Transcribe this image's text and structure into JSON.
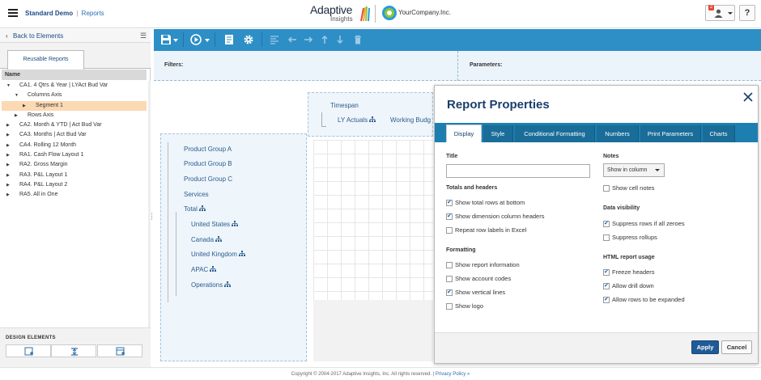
{
  "header": {
    "app_name": "Standard Demo",
    "separator": "|",
    "section": "Reports",
    "logo_main": "Adaptive",
    "logo_sub": "Insights",
    "company_logo": "YourCompany.Inc.",
    "notification_count": "2",
    "help_label": "?"
  },
  "sidebar": {
    "back_label": "Back to Elements",
    "tab_label": "Reusable Reports",
    "tree_header": "Name",
    "tree": [
      {
        "label": "CA1. 4 Qtrs & Year | LYAct Bud Var",
        "level": 0,
        "toggle": "▼",
        "selected": false
      },
      {
        "label": "Columns Axis",
        "level": 1,
        "toggle": "▼",
        "selected": false
      },
      {
        "label": "Segment 1",
        "level": 2,
        "toggle": "▶",
        "selected": true
      },
      {
        "label": "Rows Axis",
        "level": 1,
        "toggle": "▶",
        "selected": false
      },
      {
        "label": "CA2. Month & YTD | Act Bud Var",
        "level": 0,
        "toggle": "▶",
        "selected": false
      },
      {
        "label": "CA3. Months | Act Bud Var",
        "level": 0,
        "toggle": "▶",
        "selected": false
      },
      {
        "label": "CA4. Rolling 12 Month",
        "level": 0,
        "toggle": "▶",
        "selected": false
      },
      {
        "label": "RA1. Cash Flow Layout 1",
        "level": 0,
        "toggle": "▶",
        "selected": false
      },
      {
        "label": "RA2. Gross Margin",
        "level": 0,
        "toggle": "▶",
        "selected": false
      },
      {
        "label": "RA3. P&L Layout 1",
        "level": 0,
        "toggle": "▶",
        "selected": false
      },
      {
        "label": "RA4. P&L Layout 2",
        "level": 0,
        "toggle": "▶",
        "selected": false
      },
      {
        "label": "RA5. All in One",
        "level": 0,
        "toggle": "▶",
        "selected": false
      }
    ],
    "design_title": "DESIGN ELEMENTS"
  },
  "filters": {
    "filters_label": "Filters:",
    "parameters_label": "Parameters:"
  },
  "report": {
    "timespan": "Timespan",
    "col1": "LY Actuals",
    "col2": "Working Budg",
    "rows": [
      {
        "label": "Product Group A",
        "indent": 0,
        "tree_icon": false
      },
      {
        "label": "Product Group B",
        "indent": 0,
        "tree_icon": false
      },
      {
        "label": "Product Group C",
        "indent": 0,
        "tree_icon": false
      },
      {
        "label": "Services",
        "indent": 0,
        "tree_icon": false
      },
      {
        "label": "Total",
        "indent": 0,
        "tree_icon": true
      },
      {
        "label": "United States",
        "indent": 1,
        "tree_icon": true
      },
      {
        "label": "Canada",
        "indent": 1,
        "tree_icon": true
      },
      {
        "label": "United Kingdom",
        "indent": 1,
        "tree_icon": true
      },
      {
        "label": "APAC",
        "indent": 1,
        "tree_icon": true
      },
      {
        "label": "Operations",
        "indent": 1,
        "tree_icon": true
      }
    ]
  },
  "modal": {
    "title": "Report Properties",
    "tabs": [
      "Display",
      "Style",
      "Conditional Formatting",
      "Numbers",
      "Print Parameters",
      "Charts"
    ],
    "active_tab": "Display",
    "title_label": "Title",
    "title_value": "",
    "totals_label": "Totals and headers",
    "totals": [
      {
        "label": "Show total rows at bottom",
        "checked": true
      },
      {
        "label": "Show dimension column headers",
        "checked": true
      },
      {
        "label": "Repeat row labels in Excel",
        "checked": false
      }
    ],
    "formatting_label": "Formatting",
    "formatting": [
      {
        "label": "Show report information",
        "checked": false
      },
      {
        "label": "Show account codes",
        "checked": false
      },
      {
        "label": "Show vertical lines",
        "checked": true
      },
      {
        "label": "Show logo",
        "checked": false
      }
    ],
    "notes_label": "Notes",
    "notes_select": "Show in column",
    "notes": [
      {
        "label": "Show cell notes",
        "checked": false
      }
    ],
    "visibility_label": "Data visibility",
    "visibility": [
      {
        "label": "Suppress rows if all zeroes",
        "checked": true
      },
      {
        "label": "Suppress rollups",
        "checked": false
      }
    ],
    "html_label": "HTML report usage",
    "html": [
      {
        "label": "Freeze headers",
        "checked": true
      },
      {
        "label": "Allow drill down",
        "checked": true
      },
      {
        "label": "Allow rows to be expanded",
        "checked": true
      }
    ],
    "apply_label": "Apply",
    "cancel_label": "Cancel"
  },
  "footer": {
    "copyright": "Copyright © 2004-2017 Adaptive Insights, Inc. All rights reserved. |",
    "privacy": "Privacy Policy »"
  },
  "colors": {
    "toolbar": "#2d8fc5",
    "modal_tabbar": "#1d7fb0",
    "selection": "#fbd9b3",
    "apply": "#1f5b95",
    "title": "#1b3f6b"
  }
}
